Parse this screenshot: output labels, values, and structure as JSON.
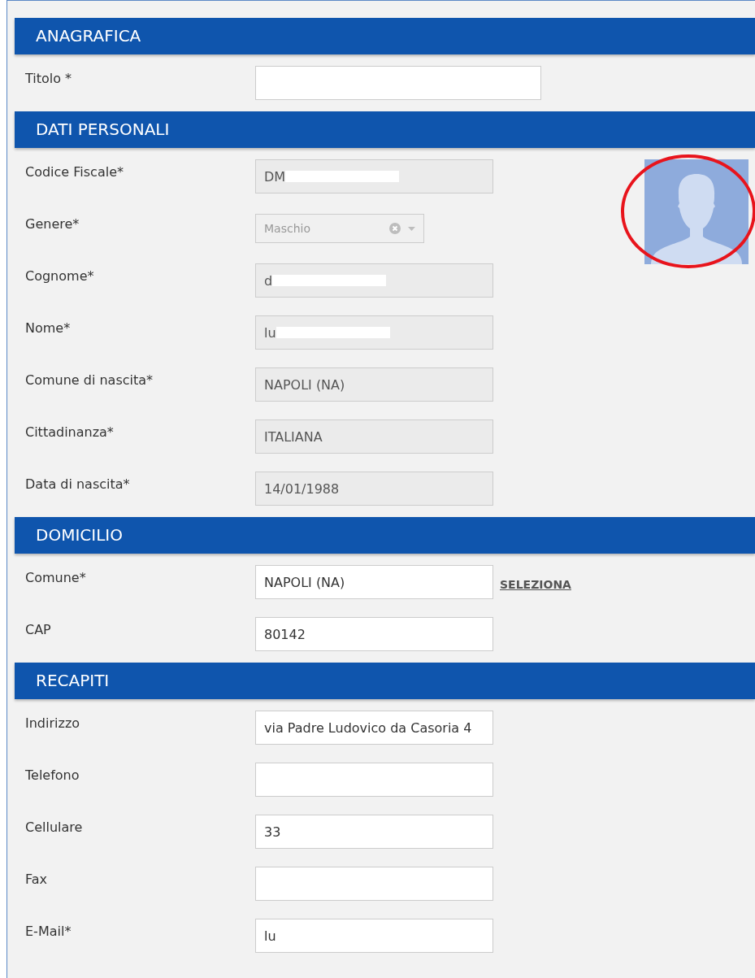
{
  "sections": [
    {
      "title": "ANAGRAFICA",
      "fields": [
        {
          "label": "Titolo *",
          "kind": "text",
          "disabled": false
        }
      ]
    },
    {
      "title": "DATI PERSONALI",
      "avatar": {
        "highlighted": true
      },
      "fields": [
        {
          "label": "Codice Fiscale*",
          "kind": "text",
          "value": "DM",
          "disabled": true,
          "redacted": true
        },
        {
          "label": "Genere*",
          "kind": "select",
          "value": "Maschio",
          "disabled": true
        },
        {
          "label": "Cognome*",
          "kind": "text",
          "value": "d",
          "disabled": true,
          "redacted": true
        },
        {
          "label": "Nome*",
          "kind": "text",
          "value": "lu",
          "disabled": true,
          "redacted": true
        },
        {
          "label": "Comune di nascita*",
          "kind": "text",
          "value": "NAPOLI (NA)",
          "disabled": true
        },
        {
          "label": "Cittadinanza*",
          "kind": "text",
          "value": "ITALIANA",
          "disabled": true
        },
        {
          "label": "Data di nascita*",
          "kind": "text",
          "value": "14/01/1988",
          "disabled": true
        }
      ]
    },
    {
      "title": "DOMICILIO",
      "fields": [
        {
          "label": "Comune*",
          "kind": "text",
          "value": "NAPOLI (NA)",
          "disabled": false,
          "link": "SELEZIONA"
        },
        {
          "label": "CAP",
          "kind": "text",
          "value": "80142",
          "disabled": false
        }
      ]
    },
    {
      "title": "RECAPITI",
      "fields": [
        {
          "label": "Indirizzo",
          "kind": "text",
          "value": "via Padre Ludovico da Casoria 4",
          "disabled": false
        },
        {
          "label": "Telefono",
          "kind": "text",
          "disabled": false
        },
        {
          "label": "Cellulare",
          "kind": "text",
          "value": "33",
          "disabled": false
        },
        {
          "label": "Fax",
          "kind": "text",
          "disabled": false
        },
        {
          "label": "E-Mail*",
          "kind": "text",
          "value": "lu",
          "disabled": false
        }
      ]
    }
  ]
}
